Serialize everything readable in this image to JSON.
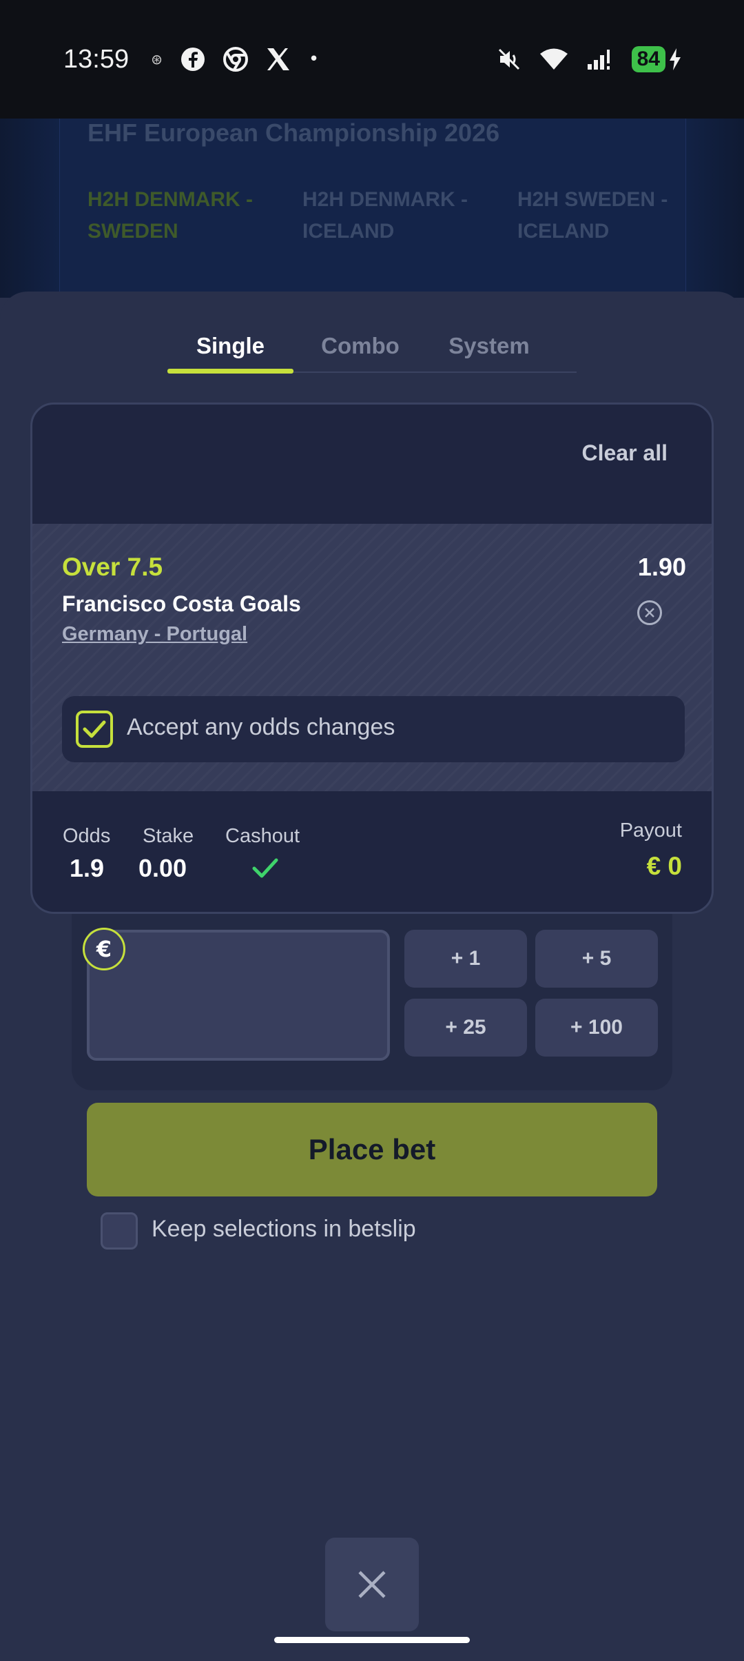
{
  "status_bar": {
    "time": "13:59",
    "battery": "84"
  },
  "background": {
    "title": "EHF European Championship 2026",
    "tabs": [
      {
        "label": "H2H DENMARK - SWEDEN"
      },
      {
        "label": "H2H DENMARK - ICELAND"
      },
      {
        "label": "H2H SWEDEN - ICELAND"
      }
    ]
  },
  "betslip": {
    "tabs": [
      {
        "label": "Single"
      },
      {
        "label": "Combo"
      },
      {
        "label": "System"
      }
    ],
    "active_tab": "Single",
    "clear_all": "Clear all",
    "selection": {
      "market": "Over 7.5",
      "player": "Francisco Costa Goals",
      "match": "Germany - Portugal",
      "odds": "1.90"
    },
    "accept_odds": {
      "label": "Accept any odds changes",
      "checked": true
    },
    "summary": {
      "odds_label": "Odds",
      "odds_value": "1.9",
      "stake_label": "Stake",
      "stake_value": "0.00",
      "cashout_label": "Cashout",
      "payout_label": "Payout",
      "payout_value": "€  0"
    },
    "stake_input": {
      "currency": "€",
      "value": ""
    },
    "quick_stakes": [
      "+ 1",
      "+ 5",
      "+ 25",
      "+ 100"
    ],
    "place_bet": "Place bet",
    "keep_selections": {
      "label": "Keep selections in betslip",
      "checked": false
    }
  },
  "colors": {
    "accent": "#c6e03c",
    "place_bet_bg": "#7c8a37",
    "sheet_bg": "#29304b",
    "card_bg": "#1f2540"
  }
}
